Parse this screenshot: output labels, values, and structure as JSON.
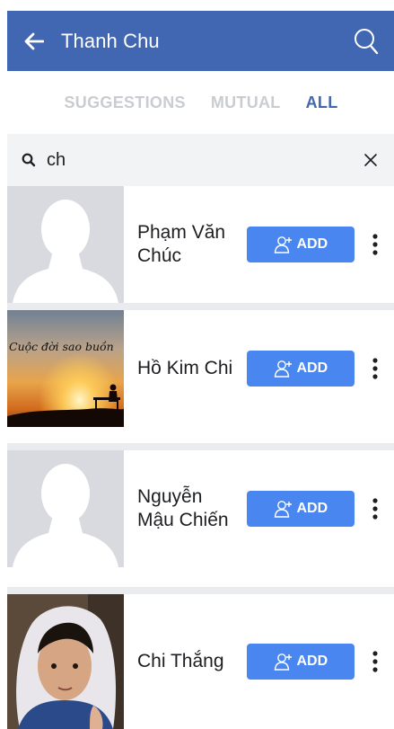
{
  "header": {
    "title": "Thanh Chu",
    "back_icon": "arrow-left-icon",
    "search_icon": "search-icon",
    "background": "#4267b2"
  },
  "tabs": [
    {
      "label": "SUGGESTIONS",
      "active": false
    },
    {
      "label": "MUTUAL",
      "active": false
    },
    {
      "label": "ALL",
      "active": true
    }
  ],
  "search": {
    "value": "ch",
    "icon": "search-icon",
    "clear_icon": "close-icon"
  },
  "results": [
    {
      "name": "Phạm Văn Chúc",
      "avatar": "default-avatar",
      "add_label": "ADD"
    },
    {
      "name": "Hồ Kim Chi",
      "avatar": "sunset-photo",
      "avatar_caption": "Cuộc đời sao buồn",
      "add_label": "ADD"
    },
    {
      "name": "Nguyễn Mậu Chiến",
      "avatar": "default-avatar",
      "add_label": "ADD"
    },
    {
      "name": "Chi Thắng",
      "avatar": "child-photo",
      "add_label": "ADD"
    }
  ],
  "colors": {
    "accent": "#4267b2",
    "add_button": "#4a86f0",
    "tab_inactive": "#c9ccd1",
    "separator": "#e9ebee"
  }
}
